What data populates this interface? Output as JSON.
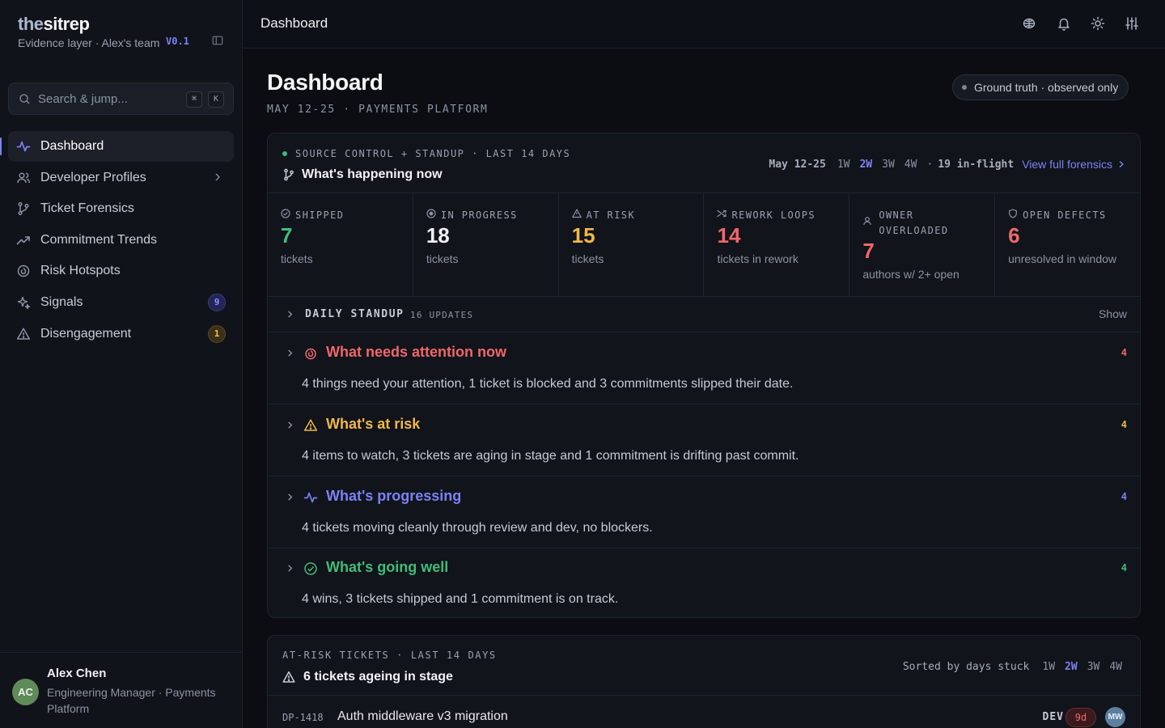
{
  "brand": {
    "logo_light": "the",
    "logo_bold": "sitrep",
    "subtitle": "Evidence layer · Alex's team",
    "version": "V0.1"
  },
  "search": {
    "placeholder": "Search & jump...",
    "kbd_1": "⌘",
    "kbd_2": "K"
  },
  "sidebar": {
    "items": [
      {
        "label": "Dashboard",
        "icon": "activity-icon",
        "active": true
      },
      {
        "label": "Developer Profiles",
        "icon": "users-icon",
        "has_chevron": true
      },
      {
        "label": "Ticket Forensics",
        "icon": "git-branch-icon"
      },
      {
        "label": "Commitment Trends",
        "icon": "trending-up-icon"
      },
      {
        "label": "Risk Hotspots",
        "icon": "flame-icon"
      },
      {
        "label": "Signals",
        "icon": "sparkle-icon",
        "badge": "9"
      },
      {
        "label": "Disengagement",
        "icon": "warning-icon",
        "badge": "1"
      }
    ]
  },
  "user": {
    "initials": "AC",
    "name": "Alex Chen",
    "role": "Engineering Manager · Payments Platform"
  },
  "topbar": {
    "title": "Dashboard"
  },
  "page": {
    "title": "Dashboard",
    "subtitle": "MAY 12-25 · PAYMENTS PLATFORM",
    "ground_truth": "Ground truth · observed only"
  },
  "overview": {
    "eyebrow": "SOURCE CONTROL + STANDUP · LAST 14 DAYS",
    "heading": "What's happening now",
    "range_label": "May 12-25",
    "ranges": [
      "1W",
      "2W",
      "3W",
      "4W"
    ],
    "selected_range": "2W",
    "sep": "·",
    "inflight": "19 in-flight",
    "link": "View full forensics"
  },
  "stats": [
    {
      "label": "SHIPPED",
      "value": "7",
      "unit": "tickets",
      "color": "#3fbd7a",
      "icon": "check-circle-icon"
    },
    {
      "label": "IN PROGRESS",
      "value": "18",
      "unit": "tickets",
      "color": "#eef0f4",
      "icon": "target-icon"
    },
    {
      "label": "AT RISK",
      "value": "15",
      "unit": "tickets",
      "color": "#f0b84a",
      "icon": "warning-icon"
    },
    {
      "label": "REWORK LOOPS",
      "value": "14",
      "unit": "tickets in rework",
      "color": "#f0676a",
      "icon": "shuffle-icon"
    },
    {
      "label": "OWNER OVERLOADED",
      "value": "7",
      "unit": "authors w/ 2+ open",
      "color": "#f0676a",
      "icon": "user-icon"
    },
    {
      "label": "OPEN DEFECTS",
      "value": "6",
      "unit": "unresolved in window",
      "color": "#f0676a",
      "icon": "shield-icon"
    }
  ],
  "standup": {
    "label": "DAILY STANDUP",
    "count": "16 UPDATES",
    "toggle": "Show"
  },
  "sections": [
    {
      "title": "What needs attention now",
      "count": "4",
      "color": "#f0676a",
      "icon": "flame-icon",
      "body": "4 things need your attention, 1 ticket is blocked and 3 commitments slipped their date."
    },
    {
      "title": "What's at risk",
      "count": "4",
      "color": "#f0b84a",
      "icon": "warning-icon",
      "body": "4 items to watch, 3 tickets are aging in stage and 1 commitment is drifting past commit."
    },
    {
      "title": "What's progressing",
      "count": "4",
      "color": "#7c82f5",
      "icon": "activity-icon",
      "body": "4 tickets moving cleanly through review and dev, no blockers."
    },
    {
      "title": "What's going well",
      "count": "4",
      "color": "#3fbd7a",
      "icon": "check-circle-icon",
      "body": "4 wins, 3 tickets shipped and 1 commitment is on track."
    }
  ],
  "at_risk": {
    "eyebrow": "AT-RISK TICKETS · LAST 14 DAYS",
    "heading": "6 tickets ageing in stage",
    "sort": "Sorted by days stuck",
    "ranges": [
      "1W",
      "2W",
      "3W",
      "4W"
    ],
    "selected_range": "2W",
    "rows": [
      {
        "id": "DP-1418",
        "title": "Auth middleware v3 migration",
        "stage": "DEV",
        "days": "9d",
        "owner": "MW"
      }
    ]
  }
}
